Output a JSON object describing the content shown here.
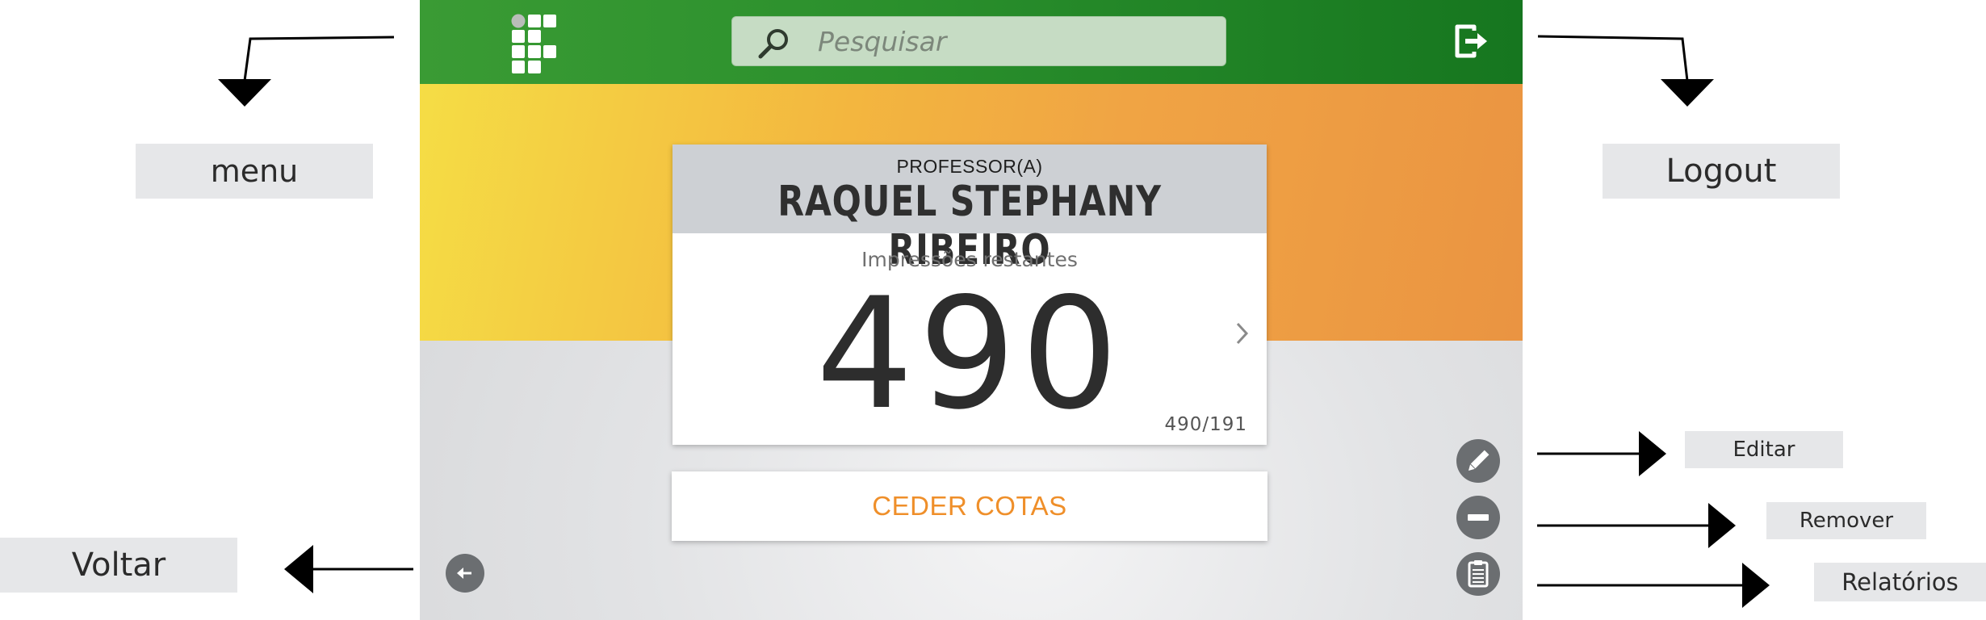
{
  "app": {
    "search_placeholder": "Pesquisar",
    "card": {
      "role": "PROFESSOR(A)",
      "name": "RAQUEL STEPHANY RIBEIRO",
      "remaining_label": "Impressões restantes",
      "remaining_count": "490",
      "ratio": "490/191"
    },
    "share_button_label": "CEDER COTAS",
    "icons": {
      "menu": "grid-menu-icon",
      "search": "search-icon",
      "logout": "logout-icon",
      "next": "chevron-right-icon",
      "edit": "pencil-icon",
      "remove": "minus-icon",
      "reports": "clipboard-icon",
      "back": "arrow-left-icon"
    },
    "colors": {
      "topbar": "#2a8f2c",
      "hero_start": "#f5dd45",
      "hero_end": "#ea9442",
      "accent_orange": "#ef8f2a",
      "fab": "#6b6e71"
    }
  },
  "annotations": {
    "menu": "menu",
    "logout": "Logout",
    "editar": "Editar",
    "remover": "Remover",
    "relatorios": "Relatórios",
    "voltar": "Voltar"
  }
}
